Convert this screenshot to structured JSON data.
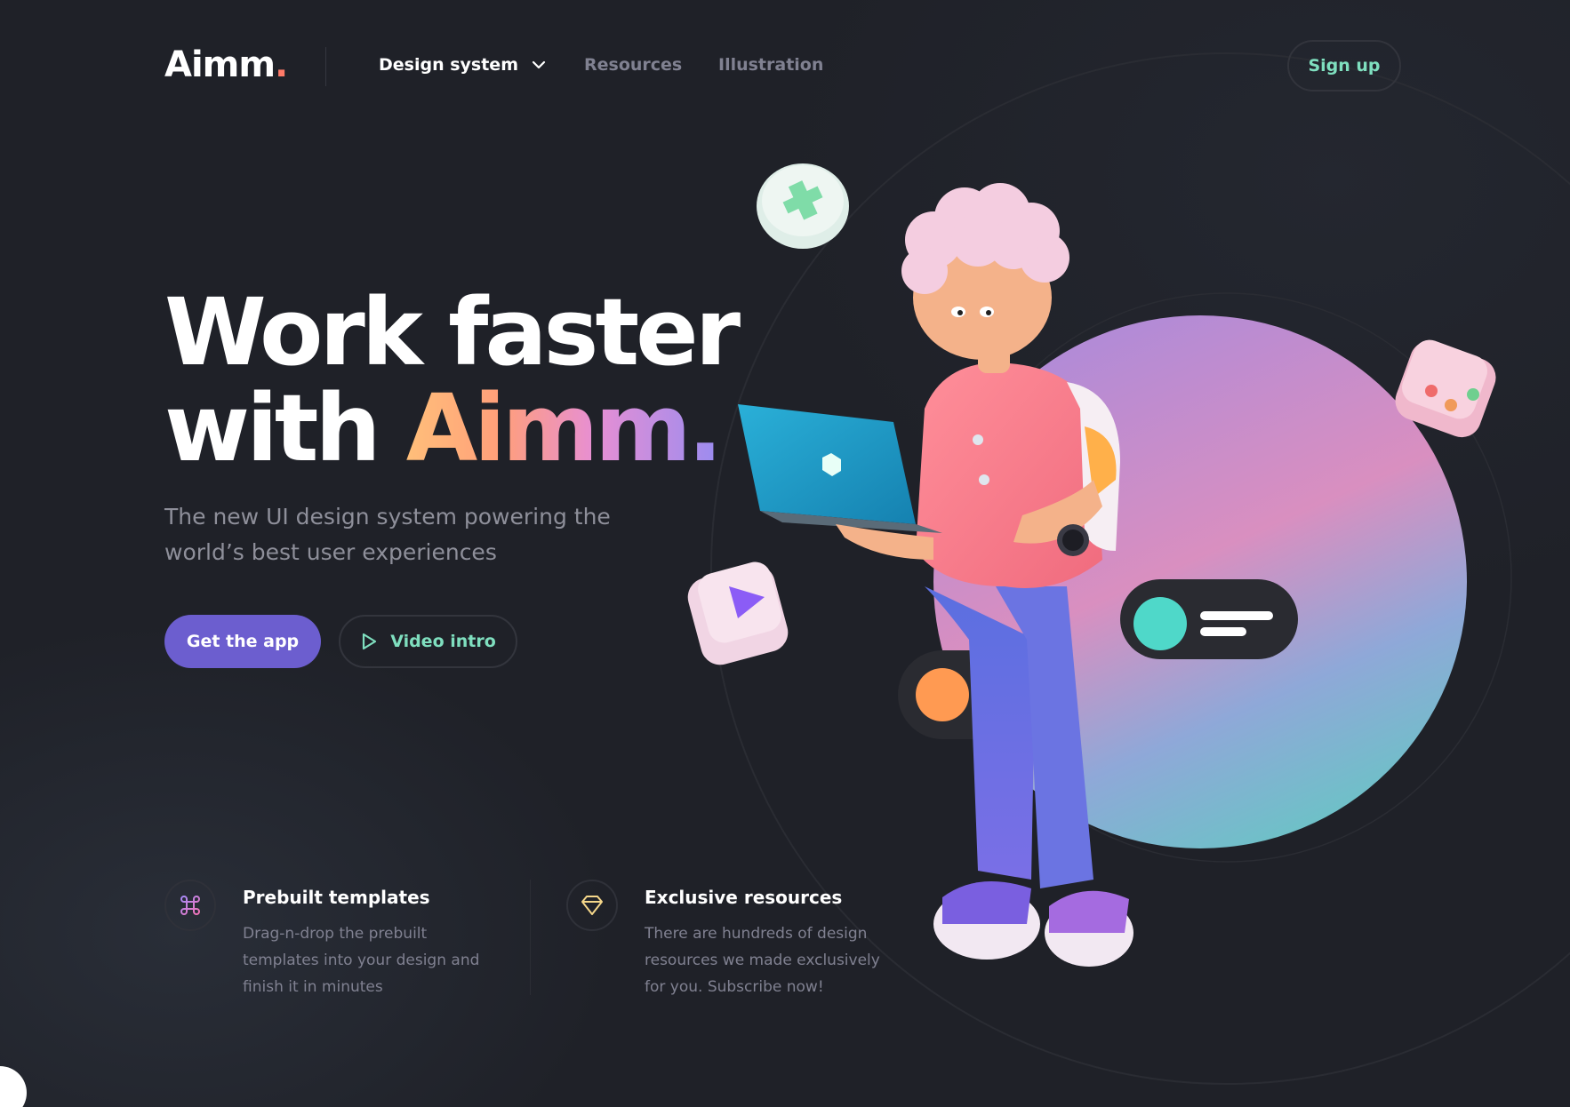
{
  "brand": {
    "name": "Aimm",
    "dot": "."
  },
  "nav": {
    "items": [
      {
        "label": "Design system",
        "has_dropdown": true,
        "active": true
      },
      {
        "label": "Resources",
        "active": false
      },
      {
        "label": "Illustration",
        "active": false
      }
    ],
    "signup_label": "Sign up"
  },
  "hero": {
    "headline_line1": "Work faster",
    "headline_line2_prefix": "with ",
    "headline_line2_brand": "Aimm.",
    "subtitle": "The new UI design system powering the world’s best user experiences",
    "primary_cta": "Get the app",
    "secondary_cta": "Video intro"
  },
  "features": [
    {
      "icon": "command-icon",
      "title": "Prebuilt templates",
      "description": "Drag-n-drop the prebuilt templates into your design and finish it in minutes"
    },
    {
      "icon": "diamond-icon",
      "title": "Exclusive resources",
      "description": "There are hundreds of design resources we made exclusively for you. Subscribe now!"
    }
  ],
  "colors": {
    "background": "#1f2128",
    "accent_green": "#7fdfbf",
    "primary_button": "#6c5ecf",
    "muted_text": "#808191",
    "logo_dot": "#ff7a68"
  }
}
